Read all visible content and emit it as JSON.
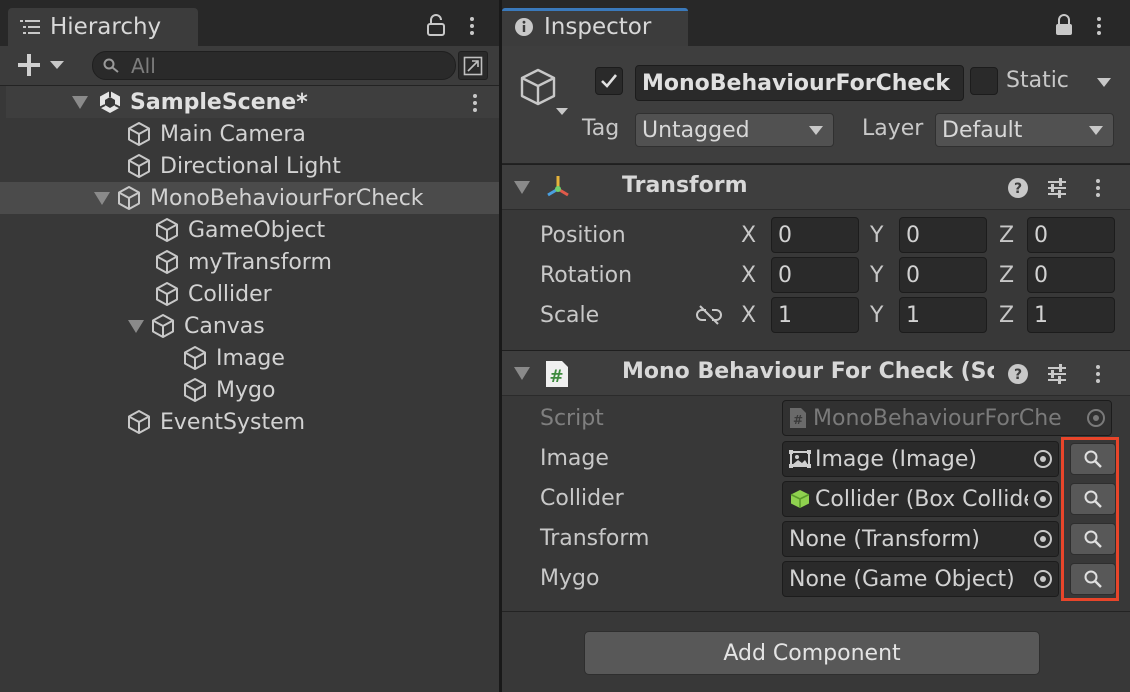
{
  "hierarchy": {
    "tab_title": "Hierarchy",
    "search_placeholder": "All",
    "scene_name": "SampleScene*",
    "items": [
      {
        "label": "Main Camera"
      },
      {
        "label": "Directional Light"
      },
      {
        "label": "MonoBehaviourForCheck"
      },
      {
        "label": "GameObject"
      },
      {
        "label": "myTransform"
      },
      {
        "label": "Collider"
      },
      {
        "label": "Canvas"
      },
      {
        "label": "Image"
      },
      {
        "label": "Mygo"
      },
      {
        "label": "EventSystem"
      }
    ]
  },
  "inspector": {
    "tab_title": "Inspector",
    "object_name": "MonoBehaviourForCheck",
    "static_label": "Static",
    "tag_label": "Tag",
    "tag_value": "Untagged",
    "layer_label": "Layer",
    "layer_value": "Default",
    "transform": {
      "title": "Transform",
      "rows": [
        {
          "label": "Position",
          "x": "0",
          "y": "0",
          "z": "0"
        },
        {
          "label": "Rotation",
          "x": "0",
          "y": "0",
          "z": "0"
        },
        {
          "label": "Scale",
          "x": "1",
          "y": "1",
          "z": "1"
        }
      ],
      "axis_x": "X",
      "axis_y": "Y",
      "axis_z": "Z"
    },
    "script_component": {
      "title": "Mono Behaviour For Check (Scri",
      "script_label": "Script",
      "script_value": "MonoBehaviourForChe",
      "fields": [
        {
          "label": "Image",
          "value": "Image (Image)"
        },
        {
          "label": "Collider",
          "value": "Collider (Box Collider)"
        },
        {
          "label": "Transform",
          "value": "None (Transform)"
        },
        {
          "label": "Mygo",
          "value": "None (Game Object)"
        }
      ]
    },
    "add_component_label": "Add Component"
  },
  "colors": {
    "selection_highlight": "#e8452a",
    "tab_accent": "#3a79bb"
  }
}
